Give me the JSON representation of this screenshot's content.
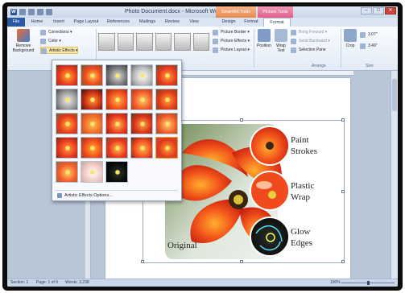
{
  "window": {
    "title": "Photo Document.docx - Microsoft Word",
    "context_tabs": {
      "smartart": "SmartArt Tools",
      "picture": "Picture Tools"
    },
    "controls": {
      "minimize": "–",
      "maximize": "□",
      "close": "✕"
    }
  },
  "quick_access": {
    "app_glyph": "W"
  },
  "tabs": [
    {
      "label": "File"
    },
    {
      "label": "Home"
    },
    {
      "label": "Insert"
    },
    {
      "label": "Page Layout"
    },
    {
      "label": "References"
    },
    {
      "label": "Mailings"
    },
    {
      "label": "Review"
    },
    {
      "label": "View"
    },
    {
      "label": "Design"
    },
    {
      "label": "Format"
    },
    {
      "label": "Format"
    }
  ],
  "ribbon": {
    "remove_background": "Remove Background",
    "corrections": "Corrections ▾",
    "color": "Color ▾",
    "artistic_effects": "Artistic Effects ▾",
    "picture_border": "Picture Border ▾",
    "picture_effects": "Picture Effects ▾",
    "picture_layout": "Picture Layout ▾",
    "position": "Position",
    "wrap_text": "Wrap Text",
    "bring_forward": "Bring Forward ▾",
    "send_backward": "Send Backward ▾",
    "selection_pane": "Selection Pane",
    "crop": "Crop",
    "height": "3.07\"",
    "width": "3.49\"",
    "group_arrange": "Arrange",
    "group_size": "Size"
  },
  "gallery": {
    "options_label": "Artistic Effects Options..."
  },
  "picture_labels": {
    "original": "Original",
    "paint_strokes": [
      "Paint",
      "Strokes"
    ],
    "plastic_wrap": [
      "Plastic",
      "Wrap"
    ],
    "glow_edges": [
      "Glow",
      "Edges"
    ]
  },
  "status": {
    "section": "Section: 1",
    "page": "Page: 1 of 9",
    "words": "Words: 3,238",
    "zoom_percent": "100%",
    "zoom_level": 0.5
  },
  "colors": {
    "file_tab": "#2a5aa6",
    "smartart_context": "#e58a4f",
    "picture_context": "#dd5e8c",
    "tulip_red": "#e8361e",
    "tulip_orange": "#ff8a1f"
  }
}
